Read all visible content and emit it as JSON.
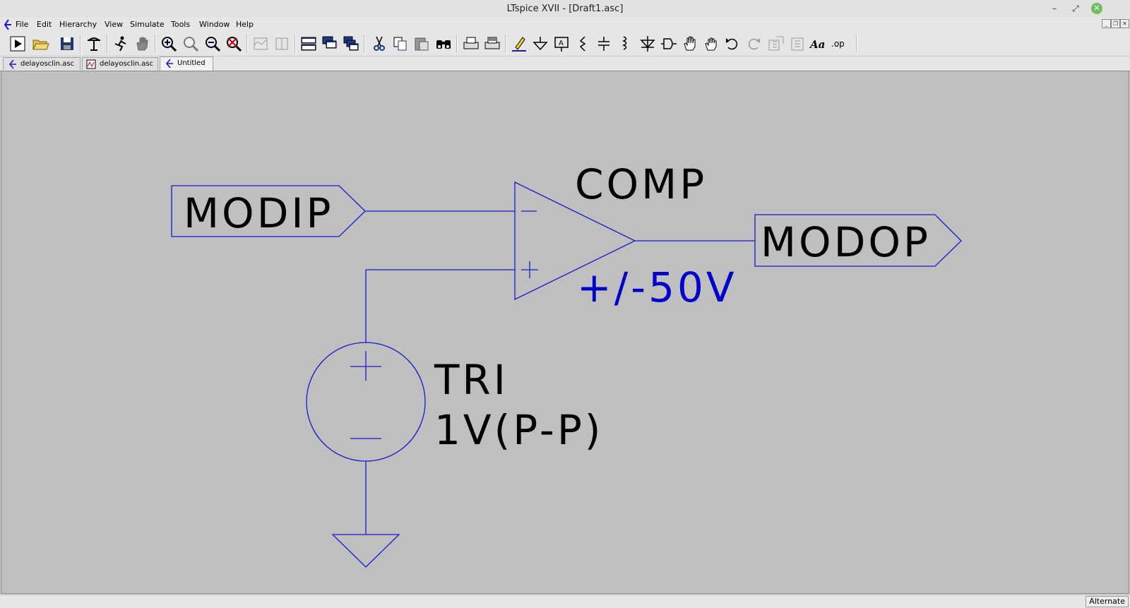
{
  "window": {
    "title": "LTspice XVII - [Draft1.asc]"
  },
  "menu": [
    {
      "label": "File"
    },
    {
      "label": "Edit"
    },
    {
      "label": "Hierarchy"
    },
    {
      "label": "View"
    },
    {
      "label": "Simulate"
    },
    {
      "label": "Tools"
    },
    {
      "label": "Window"
    },
    {
      "label": "Help"
    }
  ],
  "toolbar": {
    "icons": [
      "run-icon",
      "open-icon",
      "save-icon",
      "control-panel-icon",
      "halt-icon",
      "hand-stop-icon",
      "zoom-in-icon",
      "zoom-area-icon",
      "zoom-out-icon",
      "zoom-fit-icon",
      "autorange-icon",
      "mark-icon",
      "tile-horizontal-icon",
      "tile-vertical-icon",
      "cascade-icon",
      "cut-icon",
      "copy-icon",
      "paste-icon",
      "find-icon",
      "print-icon",
      "print-preview-icon",
      "draw-wire-icon",
      "ground-icon",
      "net-label-icon",
      "resistor-icon",
      "capacitor-icon",
      "inductor-icon",
      "diode-icon",
      "component-icon",
      "move-icon",
      "drag-icon",
      "undo-icon",
      "redo-icon",
      "rotate-icon",
      "mirror-icon",
      "text-icon",
      "spice-directive-icon"
    ],
    "text_label": "Aa",
    "op_label": ".op"
  },
  "tabs": [
    {
      "label": "delayosclin.asc",
      "icon": "schematic-icon"
    },
    {
      "label": "delayosclin.asc",
      "icon": "waveform-icon"
    },
    {
      "label": "Untitled",
      "icon": "schematic-icon",
      "active": true
    }
  ],
  "schematic": {
    "input_label": "MODIP",
    "output_label": "MODOP",
    "comparator_name": "COMP",
    "comparator_supply": "+/-50V",
    "source_name": "TRI",
    "source_value": "1V(P-P)",
    "colors": {
      "wire": "#1a1acc",
      "supply_text": "#0000cc",
      "background": "#bfbfbf"
    }
  },
  "status": {
    "mode": "Alternate"
  }
}
